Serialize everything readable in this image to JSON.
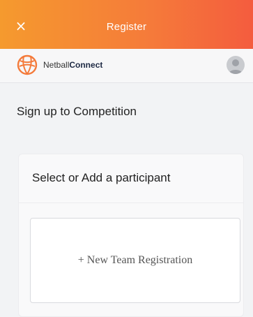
{
  "titlebar": {
    "title": "Register",
    "close_glyph": "×"
  },
  "appbar": {
    "brand_prefix": "Netball",
    "brand_suffix": "Connect",
    "logo_icon": "netball-icon",
    "avatar_icon": "user-avatar-icon"
  },
  "page": {
    "heading": "Sign up to Competition"
  },
  "participant_card": {
    "title": "Select or Add a participant",
    "new_team_label": "+ New Team Registration"
  },
  "colors": {
    "header_gradient_start": "#f59a2e",
    "header_gradient_end": "#f45c3e",
    "background": "#f2f3f5",
    "logo_orange": "#f47a3a"
  }
}
